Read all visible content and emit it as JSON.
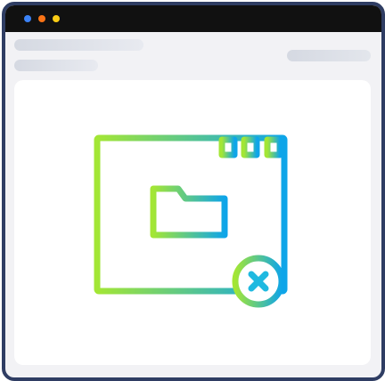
{
  "window": {
    "titlebar_color": "#111111",
    "frame_color": "#2f3d63",
    "traffic_lights": [
      "#3b82f6",
      "#f97316",
      "#facc15"
    ]
  },
  "illustration": {
    "icon": "window-with-folder-error-icon",
    "gradient": [
      "#a3e635",
      "#0ea5e9"
    ],
    "status_icon": "close-icon"
  }
}
